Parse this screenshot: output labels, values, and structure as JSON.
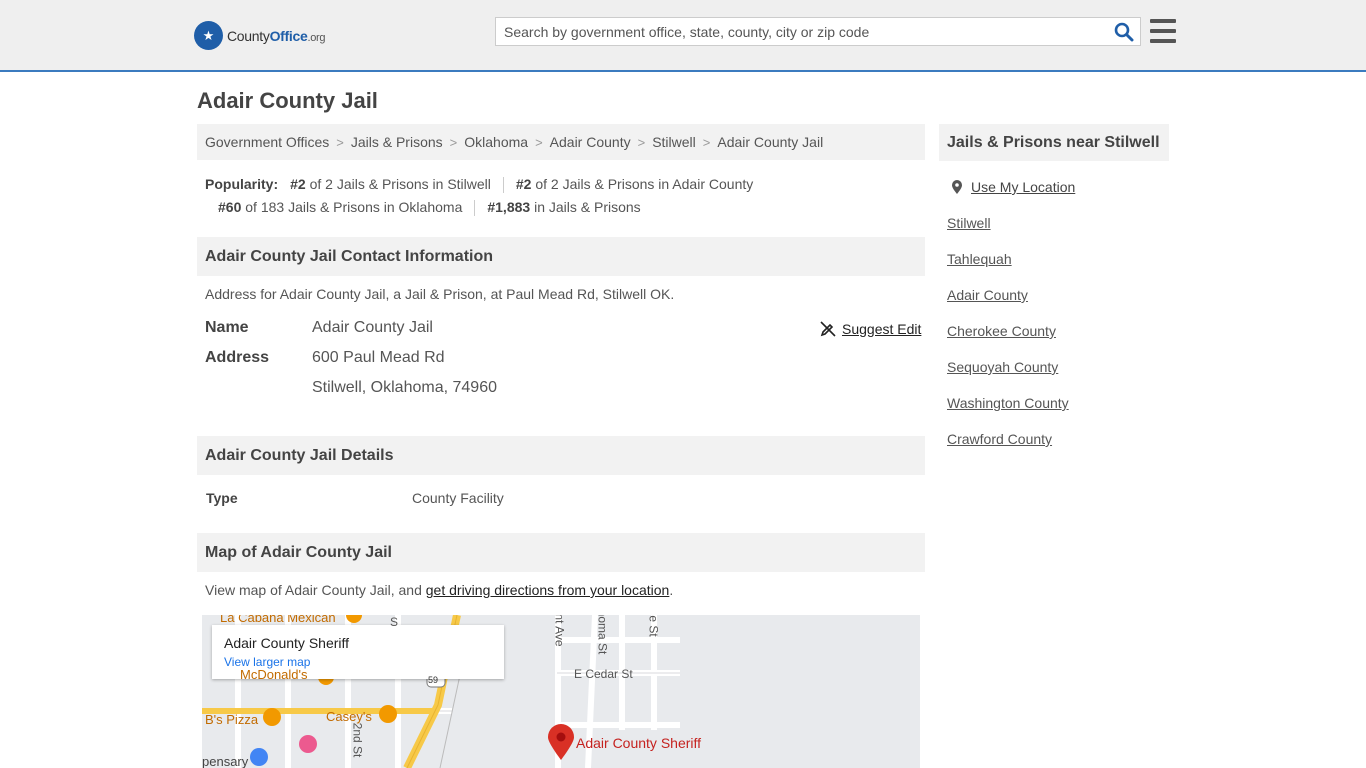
{
  "header": {
    "logo_main": "County",
    "logo_bold": "Office",
    "logo_tld": ".org",
    "search_placeholder": "Search by government office, state, county, city or zip code"
  },
  "page": {
    "title": "Adair County Jail"
  },
  "breadcrumbs": [
    "Government Offices",
    "Jails & Prisons",
    "Oklahoma",
    "Adair County",
    "Stilwell",
    "Adair County Jail"
  ],
  "popularity": {
    "label": "Popularity:",
    "items": [
      {
        "rank": "#2",
        "text": " of 2 Jails & Prisons in Stilwell"
      },
      {
        "rank": "#2",
        "text": " of 2 Jails & Prisons in Adair County"
      },
      {
        "rank": "#60",
        "text": " of 183 Jails & Prisons in Oklahoma"
      },
      {
        "rank": "#1,883",
        "text": " in Jails & Prisons"
      }
    ]
  },
  "contact": {
    "heading": "Adair County Jail Contact Information",
    "description": "Address for Adair County Jail, a Jail & Prison, at Paul Mead Rd, Stilwell OK.",
    "name_label": "Name",
    "name_value": "Adair County Jail",
    "address_label": "Address",
    "address_line1": "600 Paul Mead Rd",
    "address_line2": "Stilwell, Oklahoma, 74960",
    "suggest_edit": "Suggest Edit"
  },
  "details": {
    "heading": "Adair County Jail Details",
    "type_label": "Type",
    "type_value": "County Facility"
  },
  "map_section": {
    "heading": "Map of Adair County Jail",
    "desc_prefix": "View map of Adair County Jail, and ",
    "desc_link": "get driving directions from your location",
    "desc_suffix": ".",
    "card_title": "Adair County Sheriff",
    "card_link": "View larger map",
    "labels": {
      "mexican": "La Cabana Mexican",
      "mcdonalds": "McDonald's",
      "bs_pizza": "B's Pizza",
      "caseys": "Casey's",
      "dispensary": "pensary",
      "cedar": "E Cedar St",
      "sheriff_pin": "Adair County Sheriff",
      "second_st": "2nd St",
      "route": "59",
      "oklahoma_st": "homa St",
      "state_ave": "nt Ave",
      "e_st": "e St",
      "s_label": "S"
    }
  },
  "sidebar": {
    "heading": "Jails & Prisons near Stilwell",
    "use_location": "Use My Location",
    "links": [
      "Stilwell",
      "Tahlequah",
      "Adair County",
      "Cherokee County",
      "Sequoyah County",
      "Washington County",
      "Crawford County"
    ]
  },
  "colors": {
    "brand_blue": "#1f5ea8",
    "header_bg": "#efefef",
    "section_bg": "#f2f2f2",
    "map_pin": "#d93025"
  }
}
